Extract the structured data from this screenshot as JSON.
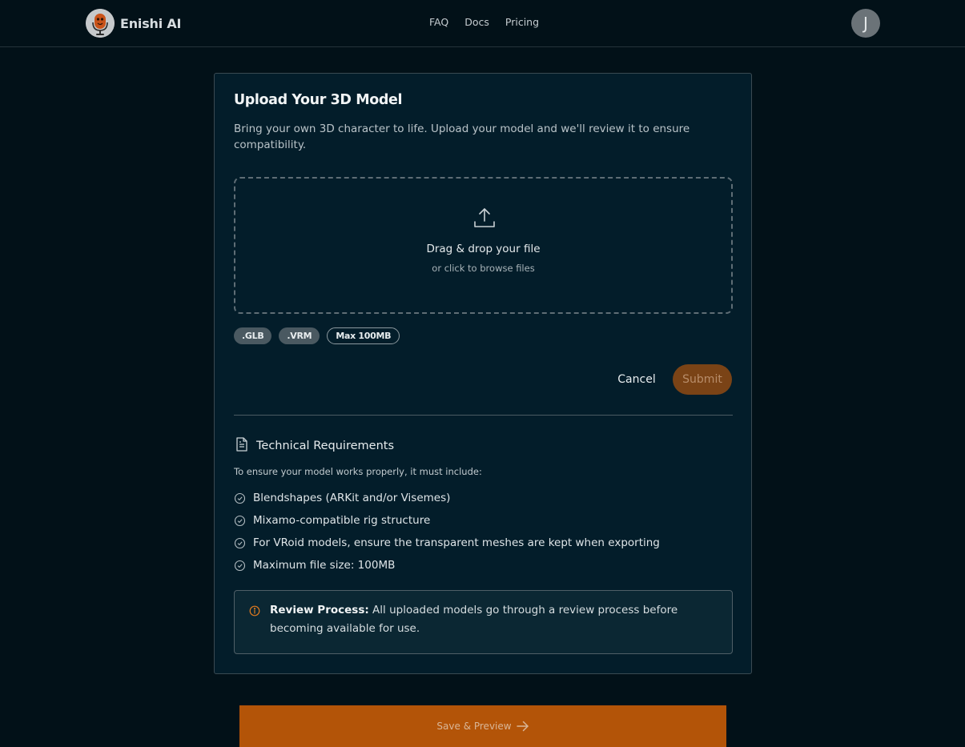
{
  "header": {
    "brand": "Enishi AI",
    "nav": [
      "FAQ",
      "Docs",
      "Pricing"
    ],
    "user_initial": "J"
  },
  "upload": {
    "title": "Upload Your 3D Model",
    "description": "Bring your own 3D character to life. Upload your model and we'll review it to ensure compatibility.",
    "drop_title": "Drag & drop your file",
    "drop_subtitle": "or click to browse files",
    "chips": [
      ".GLB",
      ".VRM",
      "Max 100MB"
    ],
    "cancel_label": "Cancel",
    "submit_label": "Submit"
  },
  "requirements": {
    "title": "Technical Requirements",
    "intro": "To ensure your model works properly, it must include:",
    "items": [
      "Blendshapes (ARKit and/or Visemes)",
      "Mixamo-compatible rig structure",
      "For VRoid models, ensure the transparent meshes are kept when exporting",
      "Maximum file size: 100MB"
    ]
  },
  "notice": {
    "label": "Review Process:",
    "text": " All uploaded models go through a review process before becoming available for use."
  },
  "footer": {
    "save_label": "Save & Preview"
  },
  "colors": {
    "background": "#021118",
    "card": "#031d2a",
    "accent": "#b35408",
    "submit_disabled": "#7a4316",
    "info_icon": "#e07a1f"
  },
  "icons": {
    "logo": "microphone-mascot-icon",
    "upload": "upload-icon",
    "requirements": "document-icon",
    "check": "check-circle-icon",
    "info": "info-circle-icon",
    "arrow": "arrow-right-icon"
  }
}
